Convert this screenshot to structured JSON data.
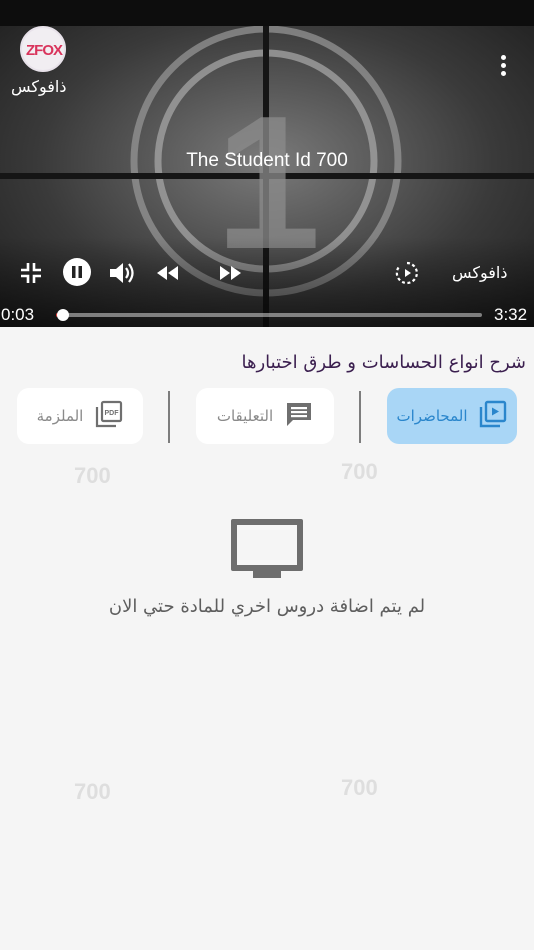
{
  "player": {
    "channel_name": "ذافوكس",
    "logo_text": "ZFOX",
    "video_title": "The Student Id 700",
    "channel_label": "ذافوكس",
    "time_current": "0:03",
    "time_total": "3:32",
    "progress_fraction": 0.015,
    "countdown_digit": "1"
  },
  "lesson": {
    "title": "شرح انواع الحساسات و طرق اختبارها"
  },
  "tabs": [
    {
      "label": "المحاضرات",
      "icon": "video-library-icon",
      "active": true
    },
    {
      "label": "التعليقات",
      "icon": "comment-icon",
      "active": false
    },
    {
      "label": "الملزمة",
      "icon": "pdf-icon",
      "active": false
    }
  ],
  "empty_state": {
    "icon": "tv-icon",
    "message": "لم يتم اضافة دروس اخري للمادة حتي الان"
  },
  "watermark_text": "700",
  "colors": {
    "active_tab_bg": "#a9d6f6",
    "active_tab_text": "#2a86cc",
    "seek_fill": "#e53935",
    "title_color": "#3b1f4f"
  }
}
